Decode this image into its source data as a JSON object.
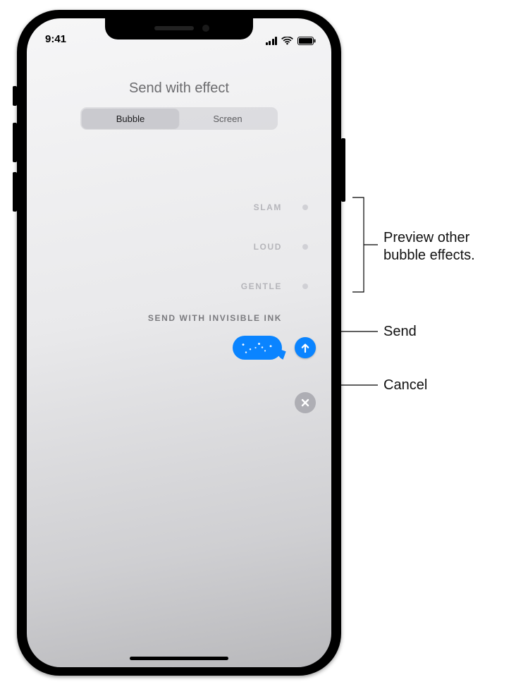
{
  "status": {
    "time": "9:41"
  },
  "header": {
    "title": "Send with effect",
    "tabs": {
      "bubble": "Bubble",
      "screen": "Screen"
    },
    "active_tab": "bubble"
  },
  "effects": {
    "items": [
      {
        "key": "slam",
        "label": "SLAM"
      },
      {
        "key": "loud",
        "label": "LOUD"
      },
      {
        "key": "gentle",
        "label": "GENTLE"
      }
    ],
    "selected": {
      "key": "invisible_ink",
      "label": "SEND WITH INVISIBLE INK"
    }
  },
  "callouts": {
    "preview": "Preview other bubble effects.",
    "send": "Send",
    "cancel": "Cancel"
  }
}
